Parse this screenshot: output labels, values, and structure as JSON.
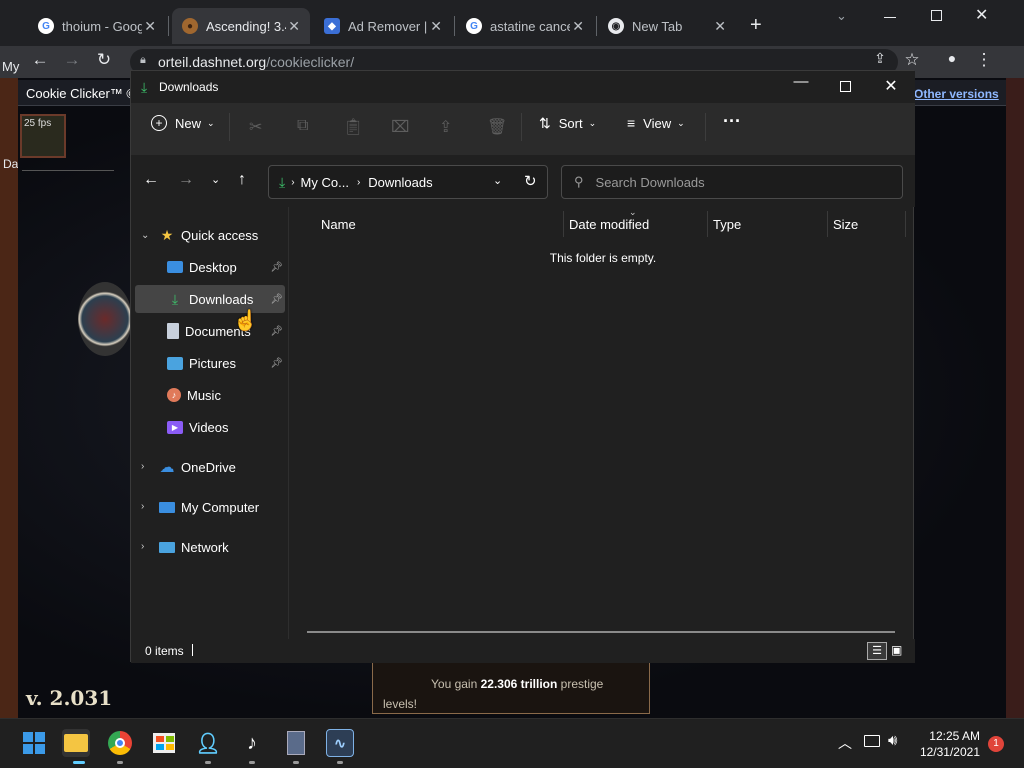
{
  "chrome": {
    "tabs": [
      {
        "title": "thoium - Goog",
        "favicon": "google-icon"
      },
      {
        "title": "Ascending! 3.4",
        "favicon": "cookie-icon"
      },
      {
        "title": "Ad Remover |",
        "favicon": "shield-icon"
      },
      {
        "title": "astatine cance",
        "favicon": "google-icon"
      },
      {
        "title": "New Tab",
        "favicon": "chrome-icon"
      }
    ],
    "url": "orteil.dashnet.org/cookieclicker/",
    "url_domain": "orteil.dashnet.org",
    "url_path": "/cookieclicker/"
  },
  "page": {
    "title": "Cookie Clicker™ ©",
    "fps": "25 fps",
    "other_versions": "Other versions",
    "version": "v. 2.031",
    "left_fragment_1": "My",
    "left_fragment_2": "Da",
    "notification_text_1": "You gain ",
    "notification_strong": "22.306 trillion",
    "notification_text_2": " prestige",
    "notification_text_3": "levels!"
  },
  "explorer": {
    "title": "Downloads",
    "commands": {
      "new": "New",
      "sort": "Sort",
      "view": "View",
      "more": "···"
    },
    "breadcrumb": [
      "My Co...",
      "Downloads"
    ],
    "search_placeholder": "Search Downloads",
    "nav": {
      "quick_access": "Quick access",
      "items": [
        {
          "label": "Desktop",
          "pinned": true
        },
        {
          "label": "Downloads",
          "pinned": true
        },
        {
          "label": "Documents",
          "pinned": true
        },
        {
          "label": "Pictures",
          "pinned": true
        },
        {
          "label": "Music",
          "pinned": false
        },
        {
          "label": "Videos",
          "pinned": false
        }
      ],
      "roots": [
        "OneDrive",
        "My Computer",
        "Network"
      ]
    },
    "columns": [
      "Name",
      "Date modified",
      "Type",
      "Size"
    ],
    "empty_message": "This folder is empty.",
    "status": "0 items"
  },
  "taskbar": {
    "time": "12:25 AM",
    "date": "12/31/2021",
    "notification_count": "1"
  },
  "colors": {
    "accent": "#0078d4",
    "chrome_bg": "#202124",
    "explorer_bg": "#202020",
    "notification_badge": "#e0443a"
  }
}
